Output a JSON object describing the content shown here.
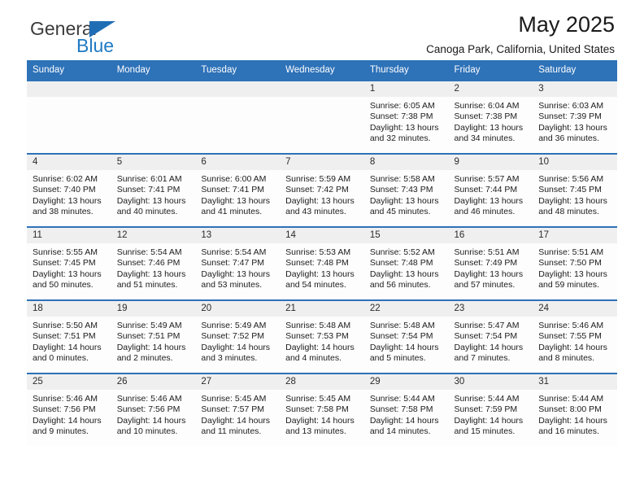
{
  "brand": {
    "name_top": "General",
    "name_bottom": "Blue",
    "triangle_color": "#1f6db5",
    "text_color_top": "#3b3b3b",
    "text_color_bottom": "#1f7ac4"
  },
  "header": {
    "month_title": "May 2025",
    "location": "Canoga Park, California, United States"
  },
  "colors": {
    "header_blue": "#2e72b8",
    "daynum_band": "#efefef",
    "cell_background": "#fdfdfd",
    "text": "#1c1c1c"
  },
  "weekdays": [
    "Sunday",
    "Monday",
    "Tuesday",
    "Wednesday",
    "Thursday",
    "Friday",
    "Saturday"
  ],
  "weeks": [
    [
      {
        "day": "",
        "empty": true
      },
      {
        "day": "",
        "empty": true
      },
      {
        "day": "",
        "empty": true
      },
      {
        "day": "",
        "empty": true
      },
      {
        "day": "1",
        "sunrise": "Sunrise: 6:05 AM",
        "sunset": "Sunset: 7:38 PM",
        "daylight1": "Daylight: 13 hours",
        "daylight2": "and 32 minutes."
      },
      {
        "day": "2",
        "sunrise": "Sunrise: 6:04 AM",
        "sunset": "Sunset: 7:38 PM",
        "daylight1": "Daylight: 13 hours",
        "daylight2": "and 34 minutes."
      },
      {
        "day": "3",
        "sunrise": "Sunrise: 6:03 AM",
        "sunset": "Sunset: 7:39 PM",
        "daylight1": "Daylight: 13 hours",
        "daylight2": "and 36 minutes."
      }
    ],
    [
      {
        "day": "4",
        "sunrise": "Sunrise: 6:02 AM",
        "sunset": "Sunset: 7:40 PM",
        "daylight1": "Daylight: 13 hours",
        "daylight2": "and 38 minutes."
      },
      {
        "day": "5",
        "sunrise": "Sunrise: 6:01 AM",
        "sunset": "Sunset: 7:41 PM",
        "daylight1": "Daylight: 13 hours",
        "daylight2": "and 40 minutes."
      },
      {
        "day": "6",
        "sunrise": "Sunrise: 6:00 AM",
        "sunset": "Sunset: 7:41 PM",
        "daylight1": "Daylight: 13 hours",
        "daylight2": "and 41 minutes."
      },
      {
        "day": "7",
        "sunrise": "Sunrise: 5:59 AM",
        "sunset": "Sunset: 7:42 PM",
        "daylight1": "Daylight: 13 hours",
        "daylight2": "and 43 minutes."
      },
      {
        "day": "8",
        "sunrise": "Sunrise: 5:58 AM",
        "sunset": "Sunset: 7:43 PM",
        "daylight1": "Daylight: 13 hours",
        "daylight2": "and 45 minutes."
      },
      {
        "day": "9",
        "sunrise": "Sunrise: 5:57 AM",
        "sunset": "Sunset: 7:44 PM",
        "daylight1": "Daylight: 13 hours",
        "daylight2": "and 46 minutes."
      },
      {
        "day": "10",
        "sunrise": "Sunrise: 5:56 AM",
        "sunset": "Sunset: 7:45 PM",
        "daylight1": "Daylight: 13 hours",
        "daylight2": "and 48 minutes."
      }
    ],
    [
      {
        "day": "11",
        "sunrise": "Sunrise: 5:55 AM",
        "sunset": "Sunset: 7:45 PM",
        "daylight1": "Daylight: 13 hours",
        "daylight2": "and 50 minutes."
      },
      {
        "day": "12",
        "sunrise": "Sunrise: 5:54 AM",
        "sunset": "Sunset: 7:46 PM",
        "daylight1": "Daylight: 13 hours",
        "daylight2": "and 51 minutes."
      },
      {
        "day": "13",
        "sunrise": "Sunrise: 5:54 AM",
        "sunset": "Sunset: 7:47 PM",
        "daylight1": "Daylight: 13 hours",
        "daylight2": "and 53 minutes."
      },
      {
        "day": "14",
        "sunrise": "Sunrise: 5:53 AM",
        "sunset": "Sunset: 7:48 PM",
        "daylight1": "Daylight: 13 hours",
        "daylight2": "and 54 minutes."
      },
      {
        "day": "15",
        "sunrise": "Sunrise: 5:52 AM",
        "sunset": "Sunset: 7:48 PM",
        "daylight1": "Daylight: 13 hours",
        "daylight2": "and 56 minutes."
      },
      {
        "day": "16",
        "sunrise": "Sunrise: 5:51 AM",
        "sunset": "Sunset: 7:49 PM",
        "daylight1": "Daylight: 13 hours",
        "daylight2": "and 57 minutes."
      },
      {
        "day": "17",
        "sunrise": "Sunrise: 5:51 AM",
        "sunset": "Sunset: 7:50 PM",
        "daylight1": "Daylight: 13 hours",
        "daylight2": "and 59 minutes."
      }
    ],
    [
      {
        "day": "18",
        "sunrise": "Sunrise: 5:50 AM",
        "sunset": "Sunset: 7:51 PM",
        "daylight1": "Daylight: 14 hours",
        "daylight2": "and 0 minutes."
      },
      {
        "day": "19",
        "sunrise": "Sunrise: 5:49 AM",
        "sunset": "Sunset: 7:51 PM",
        "daylight1": "Daylight: 14 hours",
        "daylight2": "and 2 minutes."
      },
      {
        "day": "20",
        "sunrise": "Sunrise: 5:49 AM",
        "sunset": "Sunset: 7:52 PM",
        "daylight1": "Daylight: 14 hours",
        "daylight2": "and 3 minutes."
      },
      {
        "day": "21",
        "sunrise": "Sunrise: 5:48 AM",
        "sunset": "Sunset: 7:53 PM",
        "daylight1": "Daylight: 14 hours",
        "daylight2": "and 4 minutes."
      },
      {
        "day": "22",
        "sunrise": "Sunrise: 5:48 AM",
        "sunset": "Sunset: 7:54 PM",
        "daylight1": "Daylight: 14 hours",
        "daylight2": "and 5 minutes."
      },
      {
        "day": "23",
        "sunrise": "Sunrise: 5:47 AM",
        "sunset": "Sunset: 7:54 PM",
        "daylight1": "Daylight: 14 hours",
        "daylight2": "and 7 minutes."
      },
      {
        "day": "24",
        "sunrise": "Sunrise: 5:46 AM",
        "sunset": "Sunset: 7:55 PM",
        "daylight1": "Daylight: 14 hours",
        "daylight2": "and 8 minutes."
      }
    ],
    [
      {
        "day": "25",
        "sunrise": "Sunrise: 5:46 AM",
        "sunset": "Sunset: 7:56 PM",
        "daylight1": "Daylight: 14 hours",
        "daylight2": "and 9 minutes."
      },
      {
        "day": "26",
        "sunrise": "Sunrise: 5:46 AM",
        "sunset": "Sunset: 7:56 PM",
        "daylight1": "Daylight: 14 hours",
        "daylight2": "and 10 minutes."
      },
      {
        "day": "27",
        "sunrise": "Sunrise: 5:45 AM",
        "sunset": "Sunset: 7:57 PM",
        "daylight1": "Daylight: 14 hours",
        "daylight2": "and 11 minutes."
      },
      {
        "day": "28",
        "sunrise": "Sunrise: 5:45 AM",
        "sunset": "Sunset: 7:58 PM",
        "daylight1": "Daylight: 14 hours",
        "daylight2": "and 13 minutes."
      },
      {
        "day": "29",
        "sunrise": "Sunrise: 5:44 AM",
        "sunset": "Sunset: 7:58 PM",
        "daylight1": "Daylight: 14 hours",
        "daylight2": "and 14 minutes."
      },
      {
        "day": "30",
        "sunrise": "Sunrise: 5:44 AM",
        "sunset": "Sunset: 7:59 PM",
        "daylight1": "Daylight: 14 hours",
        "daylight2": "and 15 minutes."
      },
      {
        "day": "31",
        "sunrise": "Sunrise: 5:44 AM",
        "sunset": "Sunset: 8:00 PM",
        "daylight1": "Daylight: 14 hours",
        "daylight2": "and 16 minutes."
      }
    ]
  ]
}
